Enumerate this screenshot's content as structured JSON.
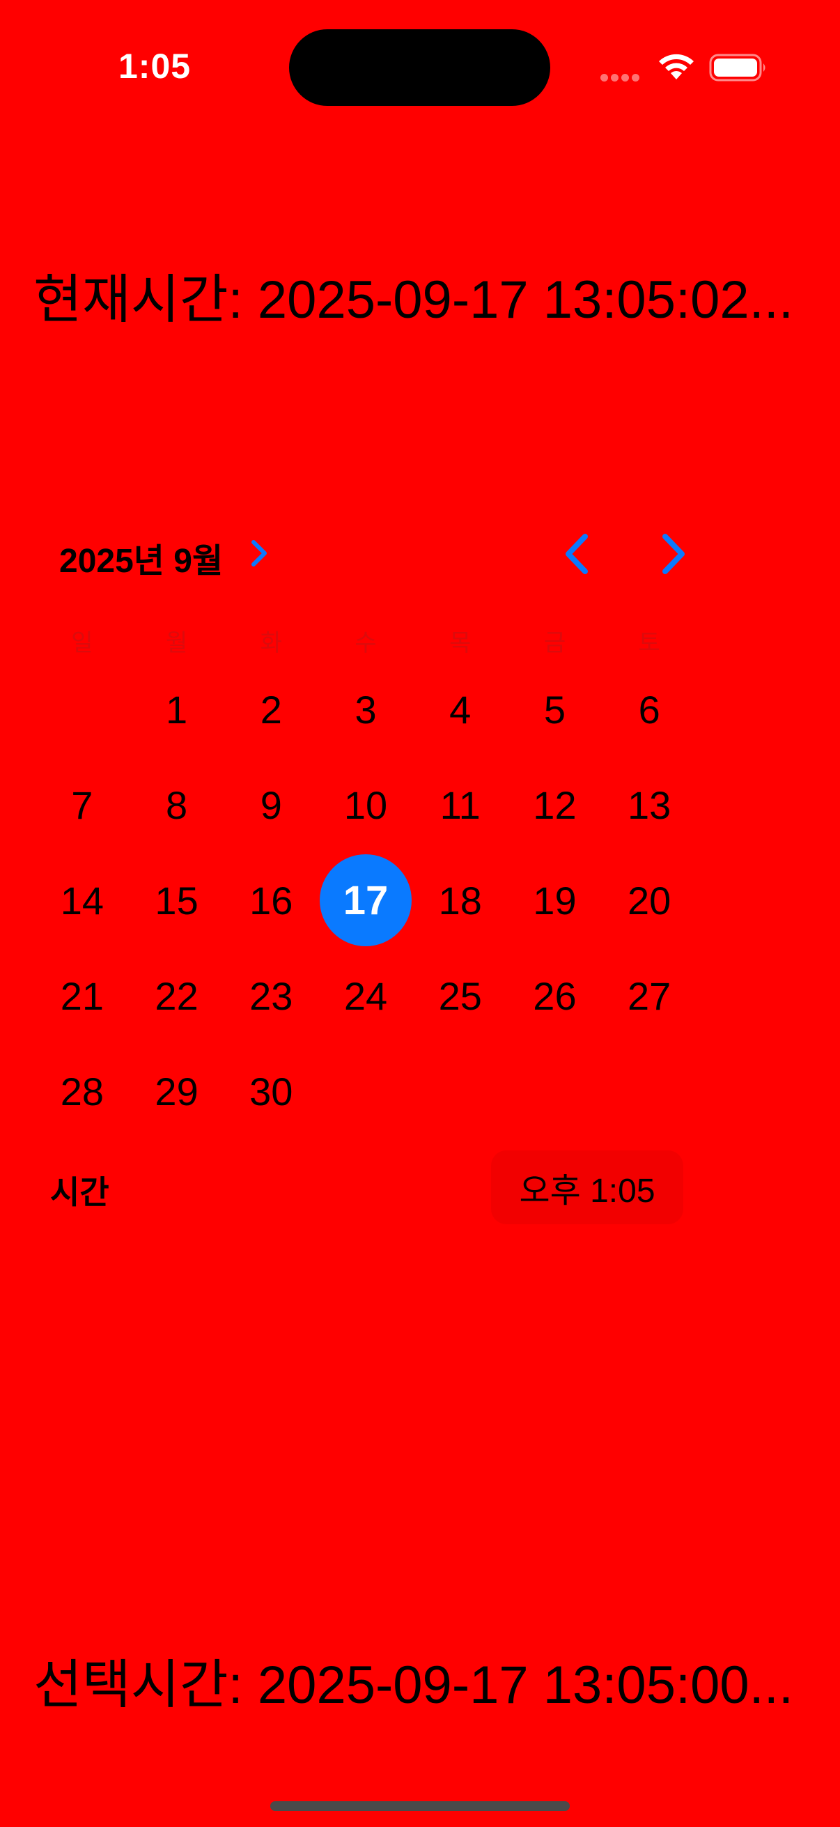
{
  "status_bar": {
    "time": "1:05",
    "icons": [
      "cellular-dots-icon",
      "wifi-icon",
      "battery-icon"
    ]
  },
  "header": {
    "current_time_text": "현재시간: 2025-09-17 13:05:02..."
  },
  "calendar": {
    "month_label": "2025년 9월",
    "weekdays": [
      "일",
      "월",
      "화",
      "수",
      "목",
      "금",
      "토"
    ],
    "weeks": [
      [
        "",
        "1",
        "2",
        "3",
        "4",
        "5",
        "6"
      ],
      [
        "7",
        "8",
        "9",
        "10",
        "11",
        "12",
        "13"
      ],
      [
        "14",
        "15",
        "16",
        "17",
        "18",
        "19",
        "20"
      ],
      [
        "21",
        "22",
        "23",
        "24",
        "25",
        "26",
        "27"
      ],
      [
        "28",
        "29",
        "30",
        "",
        "",
        "",
        ""
      ]
    ],
    "selected_day": "17",
    "accent_color": "#0A7AFF"
  },
  "time_row": {
    "label": "시간",
    "value": "오후 1:05"
  },
  "footer": {
    "selected_time_text": "선택시간: 2025-09-17 13:05:00..."
  },
  "colors": {
    "background": "#FF0000",
    "text": "#000000"
  }
}
